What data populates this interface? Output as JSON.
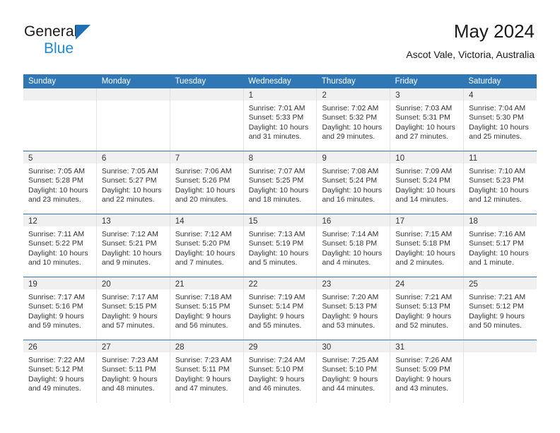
{
  "brand": {
    "line1": "General",
    "line2": "Blue",
    "triangle_color": "#1f6fb5",
    "blue_text_color": "#1f8ad4"
  },
  "header": {
    "title": "May 2024",
    "subtitle": "Ascot Vale, Victoria, Australia"
  },
  "theme": {
    "header_blue": "#3077b5",
    "daynum_band": "#f0f0f0",
    "cell_border": "#e2e2e2"
  },
  "weekdays": [
    "Sunday",
    "Monday",
    "Tuesday",
    "Wednesday",
    "Thursday",
    "Friday",
    "Saturday"
  ],
  "weeks": [
    [
      {
        "day": "",
        "lines": []
      },
      {
        "day": "",
        "lines": []
      },
      {
        "day": "",
        "lines": []
      },
      {
        "day": "1",
        "lines": [
          "Sunrise: 7:01 AM",
          "Sunset: 5:33 PM",
          "Daylight: 10 hours",
          "and 31 minutes."
        ]
      },
      {
        "day": "2",
        "lines": [
          "Sunrise: 7:02 AM",
          "Sunset: 5:32 PM",
          "Daylight: 10 hours",
          "and 29 minutes."
        ]
      },
      {
        "day": "3",
        "lines": [
          "Sunrise: 7:03 AM",
          "Sunset: 5:31 PM",
          "Daylight: 10 hours",
          "and 27 minutes."
        ]
      },
      {
        "day": "4",
        "lines": [
          "Sunrise: 7:04 AM",
          "Sunset: 5:30 PM",
          "Daylight: 10 hours",
          "and 25 minutes."
        ]
      }
    ],
    [
      {
        "day": "5",
        "lines": [
          "Sunrise: 7:05 AM",
          "Sunset: 5:28 PM",
          "Daylight: 10 hours",
          "and 23 minutes."
        ]
      },
      {
        "day": "6",
        "lines": [
          "Sunrise: 7:05 AM",
          "Sunset: 5:27 PM",
          "Daylight: 10 hours",
          "and 22 minutes."
        ]
      },
      {
        "day": "7",
        "lines": [
          "Sunrise: 7:06 AM",
          "Sunset: 5:26 PM",
          "Daylight: 10 hours",
          "and 20 minutes."
        ]
      },
      {
        "day": "8",
        "lines": [
          "Sunrise: 7:07 AM",
          "Sunset: 5:25 PM",
          "Daylight: 10 hours",
          "and 18 minutes."
        ]
      },
      {
        "day": "9",
        "lines": [
          "Sunrise: 7:08 AM",
          "Sunset: 5:24 PM",
          "Daylight: 10 hours",
          "and 16 minutes."
        ]
      },
      {
        "day": "10",
        "lines": [
          "Sunrise: 7:09 AM",
          "Sunset: 5:24 PM",
          "Daylight: 10 hours",
          "and 14 minutes."
        ]
      },
      {
        "day": "11",
        "lines": [
          "Sunrise: 7:10 AM",
          "Sunset: 5:23 PM",
          "Daylight: 10 hours",
          "and 12 minutes."
        ]
      }
    ],
    [
      {
        "day": "12",
        "lines": [
          "Sunrise: 7:11 AM",
          "Sunset: 5:22 PM",
          "Daylight: 10 hours",
          "and 10 minutes."
        ]
      },
      {
        "day": "13",
        "lines": [
          "Sunrise: 7:12 AM",
          "Sunset: 5:21 PM",
          "Daylight: 10 hours",
          "and 9 minutes."
        ]
      },
      {
        "day": "14",
        "lines": [
          "Sunrise: 7:12 AM",
          "Sunset: 5:20 PM",
          "Daylight: 10 hours",
          "and 7 minutes."
        ]
      },
      {
        "day": "15",
        "lines": [
          "Sunrise: 7:13 AM",
          "Sunset: 5:19 PM",
          "Daylight: 10 hours",
          "and 5 minutes."
        ]
      },
      {
        "day": "16",
        "lines": [
          "Sunrise: 7:14 AM",
          "Sunset: 5:18 PM",
          "Daylight: 10 hours",
          "and 4 minutes."
        ]
      },
      {
        "day": "17",
        "lines": [
          "Sunrise: 7:15 AM",
          "Sunset: 5:18 PM",
          "Daylight: 10 hours",
          "and 2 minutes."
        ]
      },
      {
        "day": "18",
        "lines": [
          "Sunrise: 7:16 AM",
          "Sunset: 5:17 PM",
          "Daylight: 10 hours",
          "and 1 minute."
        ]
      }
    ],
    [
      {
        "day": "19",
        "lines": [
          "Sunrise: 7:17 AM",
          "Sunset: 5:16 PM",
          "Daylight: 9 hours",
          "and 59 minutes."
        ]
      },
      {
        "day": "20",
        "lines": [
          "Sunrise: 7:17 AM",
          "Sunset: 5:15 PM",
          "Daylight: 9 hours",
          "and 57 minutes."
        ]
      },
      {
        "day": "21",
        "lines": [
          "Sunrise: 7:18 AM",
          "Sunset: 5:15 PM",
          "Daylight: 9 hours",
          "and 56 minutes."
        ]
      },
      {
        "day": "22",
        "lines": [
          "Sunrise: 7:19 AM",
          "Sunset: 5:14 PM",
          "Daylight: 9 hours",
          "and 55 minutes."
        ]
      },
      {
        "day": "23",
        "lines": [
          "Sunrise: 7:20 AM",
          "Sunset: 5:13 PM",
          "Daylight: 9 hours",
          "and 53 minutes."
        ]
      },
      {
        "day": "24",
        "lines": [
          "Sunrise: 7:21 AM",
          "Sunset: 5:13 PM",
          "Daylight: 9 hours",
          "and 52 minutes."
        ]
      },
      {
        "day": "25",
        "lines": [
          "Sunrise: 7:21 AM",
          "Sunset: 5:12 PM",
          "Daylight: 9 hours",
          "and 50 minutes."
        ]
      }
    ],
    [
      {
        "day": "26",
        "lines": [
          "Sunrise: 7:22 AM",
          "Sunset: 5:12 PM",
          "Daylight: 9 hours",
          "and 49 minutes."
        ]
      },
      {
        "day": "27",
        "lines": [
          "Sunrise: 7:23 AM",
          "Sunset: 5:11 PM",
          "Daylight: 9 hours",
          "and 48 minutes."
        ]
      },
      {
        "day": "28",
        "lines": [
          "Sunrise: 7:23 AM",
          "Sunset: 5:11 PM",
          "Daylight: 9 hours",
          "and 47 minutes."
        ]
      },
      {
        "day": "29",
        "lines": [
          "Sunrise: 7:24 AM",
          "Sunset: 5:10 PM",
          "Daylight: 9 hours",
          "and 46 minutes."
        ]
      },
      {
        "day": "30",
        "lines": [
          "Sunrise: 7:25 AM",
          "Sunset: 5:10 PM",
          "Daylight: 9 hours",
          "and 44 minutes."
        ]
      },
      {
        "day": "31",
        "lines": [
          "Sunrise: 7:26 AM",
          "Sunset: 5:09 PM",
          "Daylight: 9 hours",
          "and 43 minutes."
        ]
      },
      {
        "day": "",
        "lines": []
      }
    ]
  ]
}
